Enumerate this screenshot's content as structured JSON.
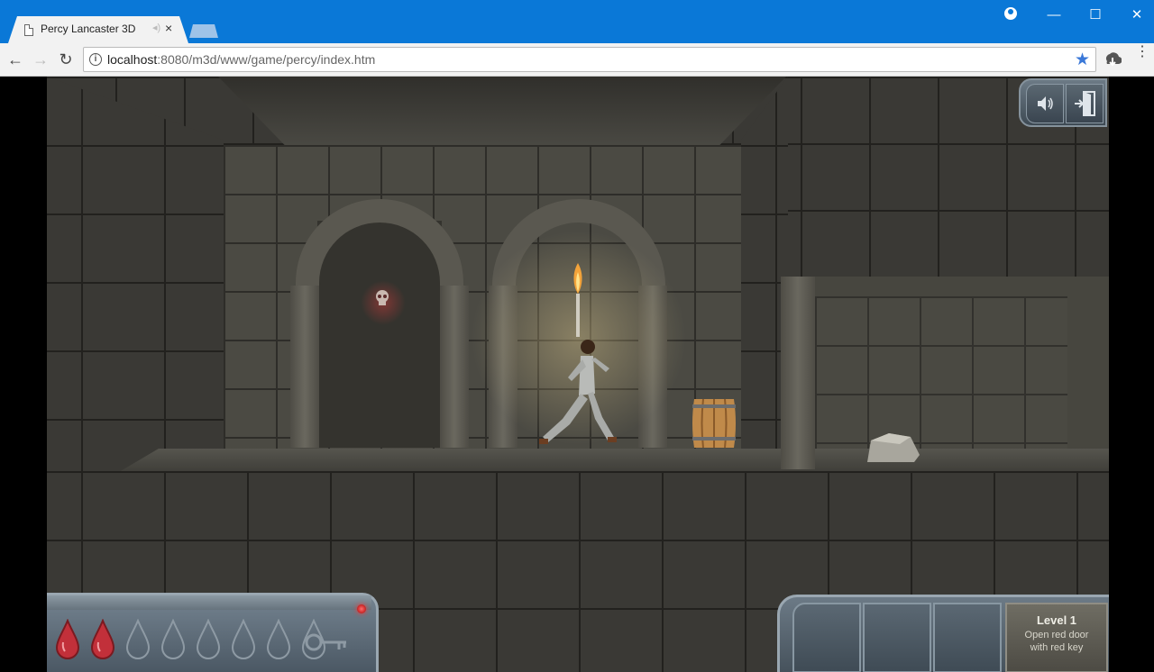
{
  "browser": {
    "tab_title": "Percy Lancaster 3D",
    "tab_close": "×",
    "url_host": "localhost",
    "url_rest": ":8080/m3d/www/game/percy/index.htm",
    "back": "←",
    "forward": "→",
    "reload": "↻",
    "minimize": "—",
    "maximize": "☐",
    "close": "✕",
    "star": "★",
    "menu": "⋮"
  },
  "hud": {
    "health": {
      "filled_drops": 2,
      "total_drops": 8
    },
    "has_key": false,
    "level": {
      "title": "Level 1",
      "objective_line1": "Open red door",
      "objective_line2": "with red key"
    },
    "inventory_slots": 3
  },
  "colors": {
    "chrome_blue": "#0a78d7",
    "blood_red": "#c2303a",
    "hud_steel": "#6c7a86"
  },
  "icons": {
    "sound": "speaker-icon",
    "exit": "exit-door-icon",
    "key": "key-icon"
  }
}
